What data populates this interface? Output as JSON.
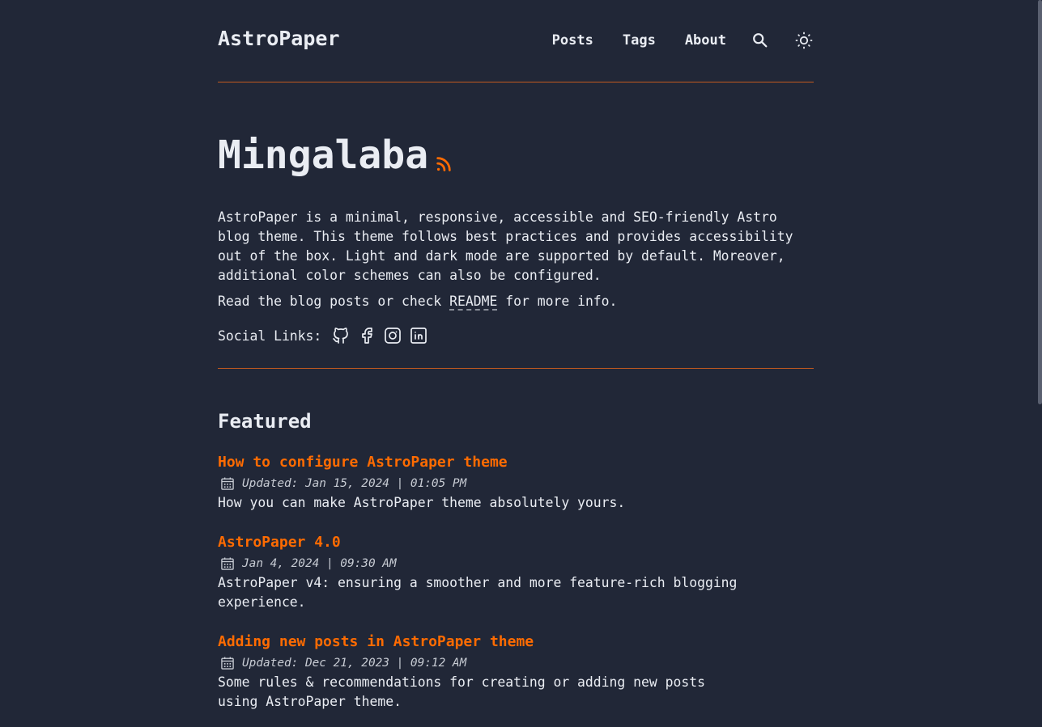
{
  "header": {
    "logo": "AstroPaper",
    "nav": {
      "posts": "Posts",
      "tags": "Tags",
      "about": "About"
    },
    "icons": [
      "search-icon",
      "sun-icon"
    ]
  },
  "hero": {
    "title": "Mingalaba",
    "rss_icon": "rss-icon",
    "description": "AstroPaper is a minimal, responsive, accessible and SEO-friendly Astro blog theme. This theme follows best practices and provides accessibility out of the box. Light and dark mode are supported by default. Moreover, additional color schemes can also be configured.",
    "readme_prefix": "Read the blog posts or check ",
    "readme_link": "README",
    "readme_suffix": " for more info.",
    "social_label": "Social Links:",
    "social_icons": [
      "github-icon",
      "facebook-icon",
      "instagram-icon",
      "linkedin-icon"
    ]
  },
  "featured": {
    "heading": "Featured",
    "posts": [
      {
        "title": "How to configure AstroPaper theme",
        "date": "Updated: Jan 15, 2024 | 01:05 PM",
        "description": "How you can make AstroPaper theme absolutely yours."
      },
      {
        "title": "AstroPaper 4.0",
        "date": "Jan 4, 2024 | 09:30 AM",
        "description": "AstroPaper v4: ensuring a smoother and more feature-rich blogging experience."
      },
      {
        "title": "Adding new posts in AstroPaper theme",
        "date": "Updated: Dec 21, 2023 | 09:12 AM",
        "description": "Some rules & recommendations for creating or adding new posts using AstroPaper theme."
      }
    ]
  },
  "colors": {
    "background": "#212737",
    "text": "#eaedf3",
    "accent": "#ff6b01",
    "border": "#c35a1f"
  }
}
